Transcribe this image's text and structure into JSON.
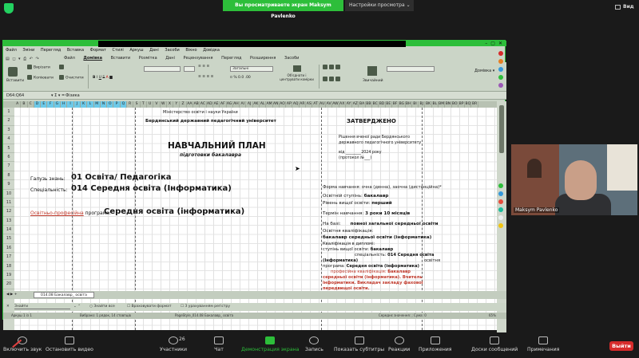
{
  "zoom": {
    "share_banner": "Вы просматриваете экран Maksym Pavlenko",
    "share_settings": "Настройки просмотра",
    "view_label": "Вид",
    "participants_count": "26",
    "participant_name": "Maksym Pavlenko",
    "toolbar": {
      "audio": "Включить звук",
      "video": "Остановить видео",
      "participants": "Участники",
      "chat": "Чат",
      "share": "Демонстрация экрана",
      "record": "Запись",
      "captions": "Показать субтитры",
      "reactions": "Реакции",
      "apps": "Приложения",
      "whiteboards": "Доски сообщений",
      "notes": "Примечания",
      "leave": "Выйти"
    }
  },
  "app": {
    "menu": [
      "Файл",
      "Зміни",
      "Перегляд",
      "Вставка",
      "Формат",
      "Стилі",
      "Аркуш",
      "Дані",
      "Засоби",
      "Вікно",
      "Довідка"
    ],
    "tabs": [
      "Файл",
      "Домівка",
      "Вставити",
      "Розмітка",
      "Дані",
      "Рецензування",
      "Перегляд",
      "Розширення",
      "Засоби"
    ],
    "active_tab": "Домівка",
    "ribbon": {
      "paste": "Вставити",
      "cut": "Вирізати",
      "copy": "Копіювати",
      "clear": "Очистити",
      "style": "Загальні",
      "merge": "Об'єднати і центрувати комірки",
      "standard": "Звичайний",
      "lang": "Домівка"
    },
    "cell_ref": "D64:Q64",
    "formula": "Фізика",
    "sheet_tab": "014.08 Бакалавр_ освіта",
    "search_placeholder": "Знайти",
    "search_options": [
      "Знайти все",
      "Враховувати формат",
      "З урахуванням регістру"
    ],
    "status": {
      "sheet": "Аркуш 1 із 1",
      "selected": "Вибрано: 1 рядок, 14 стовпців",
      "page_style": "PageStyle_014.08 Бакалавр_ освіта",
      "avg": "Середнє значення: ; Сума: 0",
      "zoom": "65%"
    },
    "row_numbers": [
      "1",
      "2",
      "3",
      "4",
      "5",
      "6",
      "7",
      "8",
      "9",
      "10",
      "11",
      "12",
      "13",
      "14",
      "15",
      "16",
      "17",
      "18",
      "19",
      "20",
      "21"
    ]
  },
  "sheet": {
    "ministry": "Міністерство освіти і науки України",
    "university": "Бердянський державний педагогічний університет",
    "approved": "ЗАТВЕРДЖЕНО",
    "decision_1": "Рішення вченої ради Бердянського",
    "decision_2": "державного педагогічного університету",
    "date_line": "від ________2024 року",
    "protocol": "(протокол №___)",
    "plan_title": "НАВЧАЛЬНИЙ ПЛАН",
    "plan_subtitle": "підготовки бакалавра",
    "field_label": "Галузь знань:",
    "field_value": "01 Освіта/ Педагогіка",
    "spec_label": "Спеціальність:",
    "spec_value": "014 Середня освіта (Інформатика)",
    "program_label_1": "Освітньо-професійна",
    "program_label_2": " програма:",
    "program_value": "Середня освіта (інформатика)",
    "form_study": "Форма навчання: очна (денна), заочна (дистанційна)*",
    "degree_label": "Освітній ступінь:",
    "degree_value": "бакалавр",
    "level_label": "Рівень вищої освіти:",
    "level_value": "перший",
    "term_label": "Термін навчання:",
    "term_value": "3 роки 10 місяців",
    "base_label": "На базі:",
    "base_value": "повної загальної середньої освіти",
    "qual_label": "Освітня кваліфікація:",
    "qual_value": "бакалавр середньої освіти (інформатика)",
    "qual_diploma": "Кваліфікація в дипломі:",
    "degree_line": "ступінь вищої освіти:",
    "degree_line_value": "бакалавр",
    "speciality_line": "спеціальність:",
    "speciality_line_value": "014 Середня освіта",
    "inf_paren": "(Інформатика)",
    "osvitnia": "освітня",
    "program_line": "програма:",
    "program_line_value": "Середня освіта (інформатика)",
    "prof_qual": "професійна кваліфікація:",
    "red_1": "Бакалавр",
    "red_2": "середньої освіти (інформатика). Вчитель",
    "red_3": "інформатики. Викладач закладу фахової",
    "red_4": "передвищої освіти."
  },
  "colors": {
    "zoom_green": "#2dbe3a",
    "leave_red": "#d62b2b",
    "ribbon_bg": "#cbd5c7",
    "selected_cols": "#6dc9e8",
    "accent_red": "#c0392b"
  }
}
